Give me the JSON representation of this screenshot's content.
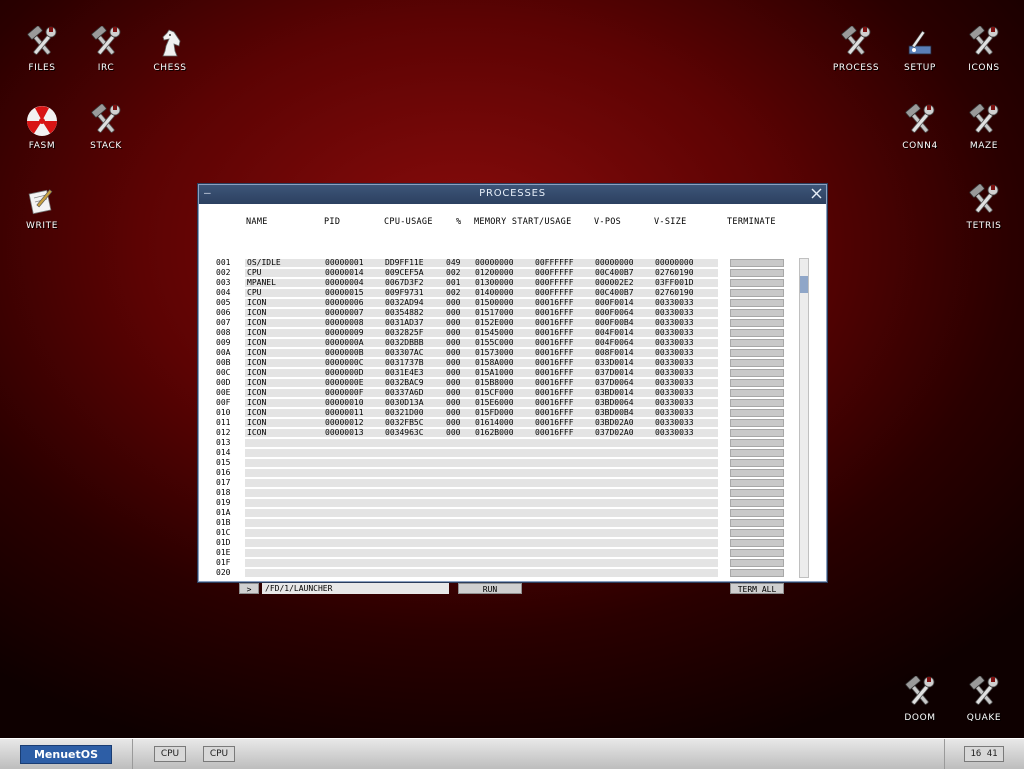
{
  "desktop": {
    "icons": {
      "files": {
        "label": "FILES",
        "icon": "tools-icon"
      },
      "irc": {
        "label": "IRC",
        "icon": "tools-icon"
      },
      "chess": {
        "label": "CHESS",
        "icon": "chess-knight-icon"
      },
      "fasm": {
        "label": "FASM",
        "icon": "radiation-icon"
      },
      "stack": {
        "label": "STACK",
        "icon": "tools-icon"
      },
      "write": {
        "label": "WRITE",
        "icon": "write-icon"
      },
      "process": {
        "label": "PROCESS",
        "icon": "tools-icon"
      },
      "setup": {
        "label": "SETUP",
        "icon": "setup-icon"
      },
      "icons": {
        "label": "ICONS",
        "icon": "tools-icon"
      },
      "conn4": {
        "label": "CONN4",
        "icon": "tools-icon"
      },
      "maze": {
        "label": "MAZE",
        "icon": "tools-icon"
      },
      "tetris": {
        "label": "TETRIS",
        "icon": "tools-icon"
      },
      "doom": {
        "label": "DOOM",
        "icon": "tools-icon"
      },
      "quake": {
        "label": "QUAKE",
        "icon": "tools-icon"
      }
    }
  },
  "window": {
    "title": "PROCESSES",
    "columns": {
      "name": "NAME",
      "pid": "PID",
      "cpu": "CPU-USAGE",
      "pct": "%",
      "memory": "MEMORY START/USAGE",
      "vpos": "V-POS",
      "vsize": "V-SIZE",
      "terminate": "TERMINATE"
    },
    "rows": [
      {
        "n": "001",
        "name": "OS/IDLE",
        "pid": "00000001",
        "cpu": "DD9FF11E",
        "pct": "049",
        "ms": "00000000",
        "mu": "00FFFFFF",
        "vpos": "00000000",
        "vsize": "00000000"
      },
      {
        "n": "002",
        "name": "CPU",
        "pid": "00000014",
        "cpu": "009CEF5A",
        "pct": "002",
        "ms": "01200000",
        "mu": "000FFFFF",
        "vpos": "00C400B7",
        "vsize": "02760190"
      },
      {
        "n": "003",
        "name": "MPANEL",
        "pid": "00000004",
        "cpu": "0067D3F2",
        "pct": "001",
        "ms": "01300000",
        "mu": "000FFFFF",
        "vpos": "000002E2",
        "vsize": "03FF001D"
      },
      {
        "n": "004",
        "name": "CPU",
        "pid": "00000015",
        "cpu": "009F9731",
        "pct": "002",
        "ms": "01400000",
        "mu": "000FFFFF",
        "vpos": "00C400B7",
        "vsize": "02760190"
      },
      {
        "n": "005",
        "name": "ICON",
        "pid": "00000006",
        "cpu": "0032AD94",
        "pct": "000",
        "ms": "01500000",
        "mu": "00016FFF",
        "vpos": "000F0014",
        "vsize": "00330033"
      },
      {
        "n": "006",
        "name": "ICON",
        "pid": "00000007",
        "cpu": "00354882",
        "pct": "000",
        "ms": "01517000",
        "mu": "00016FFF",
        "vpos": "000F0064",
        "vsize": "00330033"
      },
      {
        "n": "007",
        "name": "ICON",
        "pid": "00000008",
        "cpu": "0031AD37",
        "pct": "000",
        "ms": "0152E000",
        "mu": "00016FFF",
        "vpos": "000F00B4",
        "vsize": "00330033"
      },
      {
        "n": "008",
        "name": "ICON",
        "pid": "00000009",
        "cpu": "0032825F",
        "pct": "000",
        "ms": "01545000",
        "mu": "00016FFF",
        "vpos": "004F0014",
        "vsize": "00330033"
      },
      {
        "n": "009",
        "name": "ICON",
        "pid": "0000000A",
        "cpu": "0032DBBB",
        "pct": "000",
        "ms": "0155C000",
        "mu": "00016FFF",
        "vpos": "004F0064",
        "vsize": "00330033"
      },
      {
        "n": "00A",
        "name": "ICON",
        "pid": "0000000B",
        "cpu": "003307AC",
        "pct": "000",
        "ms": "01573000",
        "mu": "00016FFF",
        "vpos": "008F0014",
        "vsize": "00330033"
      },
      {
        "n": "00B",
        "name": "ICON",
        "pid": "0000000C",
        "cpu": "0031737B",
        "pct": "000",
        "ms": "0158A000",
        "mu": "00016FFF",
        "vpos": "033D0014",
        "vsize": "00330033"
      },
      {
        "n": "00C",
        "name": "ICON",
        "pid": "0000000D",
        "cpu": "0031E4E3",
        "pct": "000",
        "ms": "015A1000",
        "mu": "00016FFF",
        "vpos": "037D0014",
        "vsize": "00330033"
      },
      {
        "n": "00D",
        "name": "ICON",
        "pid": "0000000E",
        "cpu": "0032BAC9",
        "pct": "000",
        "ms": "015B8000",
        "mu": "00016FFF",
        "vpos": "037D0064",
        "vsize": "00330033"
      },
      {
        "n": "00E",
        "name": "ICON",
        "pid": "0000000F",
        "cpu": "00337A6D",
        "pct": "000",
        "ms": "015CF000",
        "mu": "00016FFF",
        "vpos": "03BD0014",
        "vsize": "00330033"
      },
      {
        "n": "00F",
        "name": "ICON",
        "pid": "00000010",
        "cpu": "0030D13A",
        "pct": "000",
        "ms": "015E6000",
        "mu": "00016FFF",
        "vpos": "03BD0064",
        "vsize": "00330033"
      },
      {
        "n": "010",
        "name": "ICON",
        "pid": "00000011",
        "cpu": "00321D00",
        "pct": "000",
        "ms": "015FD000",
        "mu": "00016FFF",
        "vpos": "03BD00B4",
        "vsize": "00330033"
      },
      {
        "n": "011",
        "name": "ICON",
        "pid": "00000012",
        "cpu": "0032FB5C",
        "pct": "000",
        "ms": "01614000",
        "mu": "00016FFF",
        "vpos": "03BD02A0",
        "vsize": "00330033"
      },
      {
        "n": "012",
        "name": "ICON",
        "pid": "00000013",
        "cpu": "0034963C",
        "pct": "000",
        "ms": "0162B000",
        "mu": "00016FFF",
        "vpos": "037D02A0",
        "vsize": "00330033"
      },
      {
        "n": "013"
      },
      {
        "n": "014"
      },
      {
        "n": "015"
      },
      {
        "n": "016"
      },
      {
        "n": "017"
      },
      {
        "n": "018"
      },
      {
        "n": "019"
      },
      {
        "n": "01A"
      },
      {
        "n": "01B"
      },
      {
        "n": "01C"
      },
      {
        "n": "01D"
      },
      {
        "n": "01E"
      },
      {
        "n": "01F"
      },
      {
        "n": "020"
      }
    ],
    "prompt_symbol": ">",
    "path_value": "/FD/1/LAUNCHER",
    "run_label": "RUN",
    "term_all_label": "TERM ALL"
  },
  "taskbar": {
    "menu_label": "MenuetOS",
    "tasks": [
      "CPU",
      "CPU"
    ],
    "clock": "16 41"
  },
  "colors": {
    "desktop_bg": "#5c0303",
    "titlebar": "#34496b",
    "menu_button": "#2d5ea6"
  }
}
